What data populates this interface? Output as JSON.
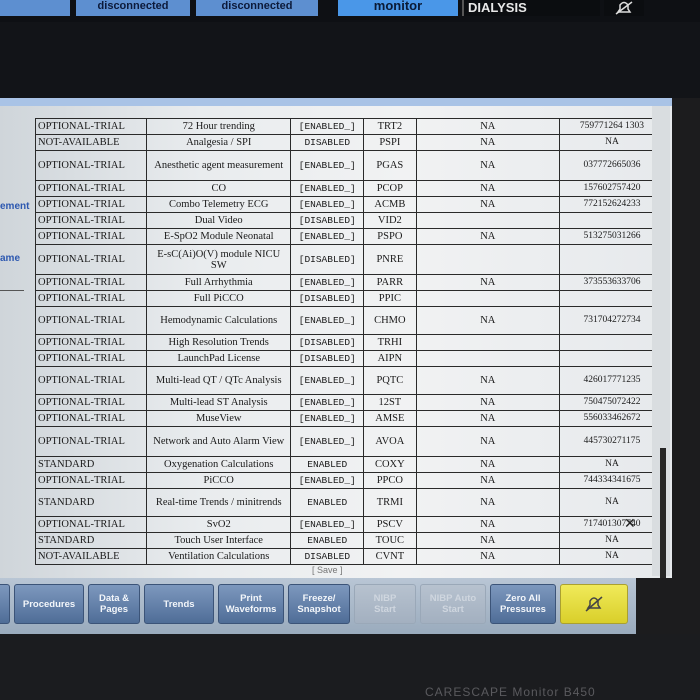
{
  "top_tabs": {
    "disconnected_1": "disconnected",
    "disconnected_2": "disconnected",
    "monitor": "monitor",
    "dialysis": "DIALYSIS",
    "alarm_icon": "bell-crossed-icon"
  },
  "side_labels": {
    "item1": "ement",
    "item2": "ame"
  },
  "rows": [
    {
      "status": "OPTIONAL-TRIAL",
      "feature": "72 Hour trending",
      "state": "[ENABLED_]",
      "code": "TRT2",
      "na": "NA",
      "key": "759771264 1303"
    },
    {
      "status": "NOT-AVAILABLE",
      "feature": "Analgesia / SPI",
      "state": "DISABLED",
      "code": "PSPI",
      "na": "NA",
      "key": "NA"
    },
    {
      "status": "OPTIONAL-TRIAL",
      "feature": "Anesthetic agent measurement",
      "state": "[ENABLED_]",
      "code": "PGAS",
      "na": "NA",
      "key": "037772665036"
    },
    {
      "status": "OPTIONAL-TRIAL",
      "feature": "CO",
      "state": "[ENABLED_]",
      "code": "PCOP",
      "na": "NA",
      "key": "157602757420"
    },
    {
      "status": "OPTIONAL-TRIAL",
      "feature": "Combo Telemetry ECG",
      "state": "[ENABLED_]",
      "code": "ACMB",
      "na": "NA",
      "key": "772152624233"
    },
    {
      "status": "OPTIONAL-TRIAL",
      "feature": "Dual Video",
      "state": "[DISABLED]",
      "code": "VID2",
      "na": "",
      "key": ""
    },
    {
      "status": "OPTIONAL-TRIAL",
      "feature": "E-SpO2 Module Neonatal",
      "state": "[ENABLED_]",
      "code": "PSPO",
      "na": "NA",
      "key": "513275031266"
    },
    {
      "status": "OPTIONAL-TRIAL",
      "feature": "E-sC(Ai)O(V) module NICU SW",
      "state": "[DISABLED]",
      "code": "PNRE",
      "na": "",
      "key": ""
    },
    {
      "status": "OPTIONAL-TRIAL",
      "feature": "Full Arrhythmia",
      "state": "[ENABLED_]",
      "code": "PARR",
      "na": "NA",
      "key": "373553633706"
    },
    {
      "status": "OPTIONAL-TRIAL",
      "feature": "Full PiCCO",
      "state": "[DISABLED]",
      "code": "PPIC",
      "na": "",
      "key": ""
    },
    {
      "status": "OPTIONAL-TRIAL",
      "feature": "Hemodynamic Calculations",
      "state": "[ENABLED_]",
      "code": "CHMO",
      "na": "NA",
      "key": "731704272734"
    },
    {
      "status": "OPTIONAL-TRIAL",
      "feature": "High Resolution Trends",
      "state": "[DISABLED]",
      "code": "TRHI",
      "na": "",
      "key": ""
    },
    {
      "status": "OPTIONAL-TRIAL",
      "feature": "LaunchPad License",
      "state": "[DISABLED]",
      "code": "AIPN",
      "na": "",
      "key": ""
    },
    {
      "status": "OPTIONAL-TRIAL",
      "feature": "Multi-lead QT / QTc Analysis",
      "state": "[ENABLED_]",
      "code": "PQTC",
      "na": "NA",
      "key": "426017771235"
    },
    {
      "status": "OPTIONAL-TRIAL",
      "feature": "Multi-lead ST Analysis",
      "state": "[ENABLED_]",
      "code": "12ST",
      "na": "NA",
      "key": "750475072422"
    },
    {
      "status": "OPTIONAL-TRIAL",
      "feature": "MuseView",
      "state": "[ENABLED_]",
      "code": "AMSE",
      "na": "NA",
      "key": "556033462672"
    },
    {
      "status": "OPTIONAL-TRIAL",
      "feature": "Network and Auto Alarm View",
      "state": "[ENABLED_]",
      "code": "AVOA",
      "na": "NA",
      "key": "445730271175"
    },
    {
      "status": "STANDARD",
      "feature": "Oxygenation Calculations",
      "state": "ENABLED",
      "code": "COXY",
      "na": "NA",
      "key": "NA"
    },
    {
      "status": "OPTIONAL-TRIAL",
      "feature": "PiCCO",
      "state": "[ENABLED_]",
      "code": "PPCO",
      "na": "NA",
      "key": "744334341675"
    },
    {
      "status": "STANDARD",
      "feature": "Real-time Trends / minitrends",
      "state": "ENABLED",
      "code": "TRMI",
      "na": "NA",
      "key": "NA"
    },
    {
      "status": "OPTIONAL-TRIAL",
      "feature": "SvO2",
      "state": "[ENABLED_]",
      "code": "PSCV",
      "na": "NA",
      "key": "717401307740"
    },
    {
      "status": "STANDARD",
      "feature": "Touch User Interface",
      "state": "ENABLED",
      "code": "TOUC",
      "na": "NA",
      "key": "NA"
    },
    {
      "status": "NOT-AVAILABLE",
      "feature": "Ventilation Calculations",
      "state": "DISABLED",
      "code": "CVNT",
      "na": "NA",
      "key": "NA"
    }
  ],
  "save_label": "[ Save ]",
  "toolbar": {
    "procedures": "Procedures",
    "data_pages": "Data &\nPages",
    "trends": "Trends",
    "print": "Print\nWaveforms",
    "freeze": "Freeze/\nSnapshot",
    "nibp_start": "NIBP\nStart",
    "nibp_auto": "NIBP Auto\nStart",
    "zero_all": "Zero All\nPressures",
    "audio_icon": "alarm-audio-icon"
  },
  "brand": "CARESCAPE Monitor B450"
}
